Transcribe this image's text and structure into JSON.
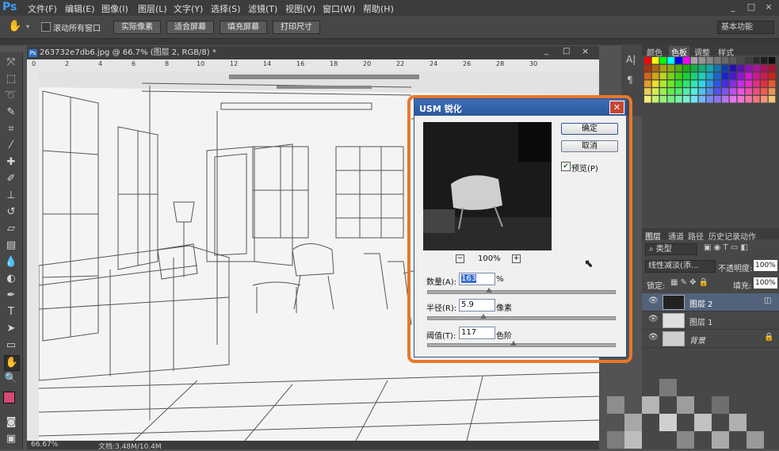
{
  "app": {
    "logo": "Ps"
  },
  "menu": [
    "文件(F)",
    "编辑(E)",
    "图像(I)",
    "图层(L)",
    "文字(Y)",
    "选择(S)",
    "滤镜(T)",
    "视图(V)",
    "窗口(W)",
    "帮助(H)"
  ],
  "window_controls": [
    "_",
    "□",
    "×"
  ],
  "options_bar": {
    "scroll_all_label": "滚动所有窗口",
    "scroll_all_checked": false,
    "buttons": [
      "实际像素",
      "适合屏幕",
      "填充屏幕",
      "打印尺寸"
    ],
    "workspace": "基本功能"
  },
  "document": {
    "tab_title": "263732e7db6.jpg @ 66.7% (图层 2, RGB/8) *",
    "ruler_marks": [
      "0",
      "2",
      "4",
      "6",
      "8",
      "10",
      "12",
      "14",
      "16",
      "18",
      "20",
      "22",
      "24",
      "26",
      "28",
      "30"
    ],
    "zoom": "66.67%",
    "doc_info": "文档:3.48M/10.4M"
  },
  "swatches_panel": {
    "tabs": [
      "颜色",
      "色板",
      "调整",
      "样式"
    ],
    "active_tab": "色板"
  },
  "layers_panel": {
    "tabs": [
      "图层",
      "通道",
      "路径",
      "历史记录",
      "动作"
    ],
    "filter_label": "类型",
    "blend_mode": "线性减淡(添...",
    "opacity_label": "不透明度:",
    "opacity": "100%",
    "lock_label": "锁定:",
    "fill_label": "填充:",
    "fill": "100%",
    "layers": [
      {
        "name": "图层 2",
        "selected": true
      },
      {
        "name": "图层 1",
        "selected": false
      },
      {
        "name": "背景",
        "selected": false,
        "locked": true
      }
    ]
  },
  "usm_dialog": {
    "title": "USM 锐化",
    "ok": "确定",
    "cancel": "取消",
    "preview_label": "预览(P)",
    "preview_checked": true,
    "zoom": "100%",
    "zoom_out": "−",
    "zoom_in": "+",
    "amount_label": "数量(A):",
    "amount": "163",
    "amount_unit": "%",
    "amount_level": 0.33,
    "radius_label": "半径(R):",
    "radius": "5.9",
    "radius_unit": "像素",
    "radius_level": 0.3,
    "threshold_label": "阈值(T):",
    "threshold": "117",
    "threshold_unit": "色阶",
    "threshold_level": 0.46
  },
  "colors": {
    "accent_orange": "#e8772a",
    "foreground": "#d44a72",
    "background": "#ffffff",
    "title_blue": "#2c579c"
  }
}
